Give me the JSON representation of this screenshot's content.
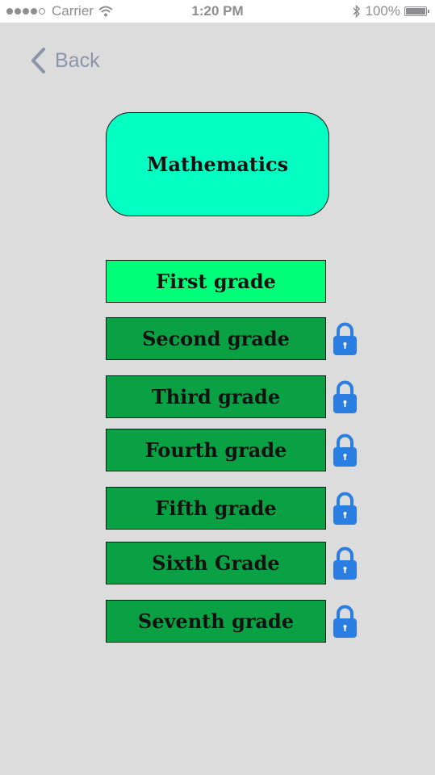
{
  "status_bar": {
    "carrier": "Carrier",
    "time": "1:20 PM",
    "battery": "100%",
    "battery_level": 1.0
  },
  "nav": {
    "back_label": "Back"
  },
  "subject": {
    "title": "Mathematics"
  },
  "grades": [
    {
      "label": "First grade",
      "locked": false
    },
    {
      "label": "Second grade",
      "locked": true
    },
    {
      "label": "Third grade",
      "locked": true
    },
    {
      "label": "Fourth grade",
      "locked": true
    },
    {
      "label": "Fifth grade",
      "locked": true
    },
    {
      "label": "Sixth Grade",
      "locked": true
    },
    {
      "label": "Seventh grade",
      "locked": true
    }
  ],
  "colors": {
    "background": "#dcdcdc",
    "subject_fill": "#03ffc2",
    "unlocked_grade": "#00ff78",
    "locked_grade": "#0aa144",
    "lock_icon": "#2a7de1"
  },
  "icons": {
    "back": "chevron-left-icon",
    "lock": "padlock-icon"
  }
}
